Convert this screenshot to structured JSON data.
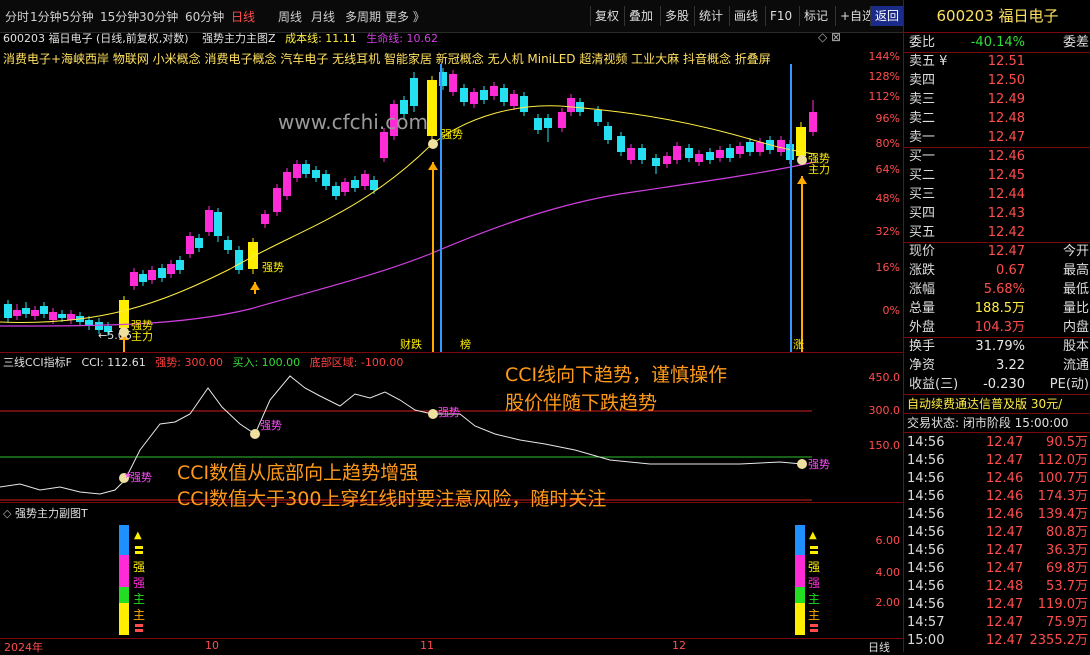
{
  "toolbar": {
    "left": [
      "分时",
      "1分钟",
      "5分钟",
      "15分钟",
      "30分钟",
      "60分钟",
      "日线",
      "周线",
      "月线",
      "多周期",
      "更多 》"
    ],
    "active": "日线",
    "right": [
      "复权",
      "叠加",
      "多股",
      "统计",
      "画线",
      "F10",
      "标记",
      "+自选",
      "返回"
    ]
  },
  "main_info": {
    "code_name": "600203 福日电子 (日线,前复权,对数)",
    "indicator": "强势主力主图Z",
    "cost_label": "成本线: 11.11",
    "life_label": "生命线: 10.62"
  },
  "concepts": "消费电子+海峡西岸 物联网 小米概念 消费电子概念 汽车电子 无线耳机 智能家居 新冠概念 无人机 MiniLED 超清视频 工业大麻 抖音概念 折叠屏",
  "watermark": "www.cfchi.com",
  "main_axis": [
    "144%",
    "128%",
    "112%",
    "96%",
    "80%",
    "64%",
    "48%",
    "32%",
    "16%",
    "0%"
  ],
  "cci_panel": {
    "title": "三线CCI指标F",
    "cci": "CCI: 112.61",
    "strong": "强势: 300.00",
    "buy": "买入: 100.00",
    "bottom": "底部区域: -100.00",
    "axis": [
      "450.0",
      "300.0",
      "150.0"
    ]
  },
  "sub_panel": {
    "title": "强势主力副图T",
    "axis": [
      "6.00",
      "4.00",
      "2.00"
    ]
  },
  "x_axis": [
    "2024年",
    "10",
    "11",
    "12",
    "日线"
  ],
  "markers": {
    "strong": "强势",
    "main": "主力",
    "cai": "财跌",
    "bang": "榜",
    "zhang": "涨",
    "cost_tag": "←5.06"
  },
  "annotations": {
    "box_line1": "CCI线向下趋势，谨慎操作",
    "box_line2": "股价伴随下跌趋势",
    "bottom_line1": "CCI数值从底部向上趋势增强",
    "bottom_line2": "CCI数值大于300上穿红线时要注意风险，随时关注"
  },
  "quote": {
    "title": "600203 福日电子",
    "weibi": {
      "label": "委比",
      "value": "-40.14%",
      "label2": "委差"
    },
    "asks": [
      {
        "label": "卖五 ¥",
        "price": "12.51"
      },
      {
        "label": "卖四",
        "price": "12.50"
      },
      {
        "label": "卖三",
        "price": "12.49"
      },
      {
        "label": "卖二",
        "price": "12.48"
      },
      {
        "label": "卖一",
        "price": "12.47"
      }
    ],
    "bids": [
      {
        "label": "买一",
        "price": "12.46"
      },
      {
        "label": "买二",
        "price": "12.45"
      },
      {
        "label": "买三",
        "price": "12.44"
      },
      {
        "label": "买四",
        "price": "12.43"
      },
      {
        "label": "买五",
        "price": "12.42"
      }
    ],
    "stats": [
      {
        "label": "现价",
        "value": "12.47",
        "right": "今开"
      },
      {
        "label": "涨跌",
        "value": "0.67",
        "right": "最高"
      },
      {
        "label": "涨幅",
        "value": "5.68%",
        "right": "最低"
      },
      {
        "label": "总量",
        "value": "188.5万",
        "right": "量比"
      },
      {
        "label": "外盘",
        "value": "104.3万",
        "right": "内盘"
      }
    ],
    "stats2": [
      {
        "label": "换手",
        "value": "31.79%",
        "right": "股本"
      },
      {
        "label": "净资",
        "value": "3.22",
        "right": "流通"
      },
      {
        "label": "收益(三)",
        "value": "-0.230",
        "right": "PE(动)"
      }
    ],
    "promo": "自动续费通达信普及版  30元/",
    "trade_state": "交易状态: 闭市阶段 15:00:00",
    "ticks": [
      {
        "t": "14:56",
        "p": "12.47",
        "v": "90.5万"
      },
      {
        "t": "14:56",
        "p": "12.47",
        "v": "112.0万"
      },
      {
        "t": "14:56",
        "p": "12.46",
        "v": "100.7万"
      },
      {
        "t": "14:56",
        "p": "12.46",
        "v": "174.3万"
      },
      {
        "t": "14:56",
        "p": "12.46",
        "v": "139.4万"
      },
      {
        "t": "14:56",
        "p": "12.47",
        "v": "80.8万"
      },
      {
        "t": "14:56",
        "p": "12.47",
        "v": "36.3万"
      },
      {
        "t": "14:56",
        "p": "12.47",
        "v": "69.8万"
      },
      {
        "t": "14:56",
        "p": "12.48",
        "v": "53.7万"
      },
      {
        "t": "14:56",
        "p": "12.47",
        "v": "119.0万"
      },
      {
        "t": "14:57",
        "p": "12.47",
        "v": "75.9万"
      },
      {
        "t": "15:00",
        "p": "12.47",
        "v": "2355.2万"
      }
    ]
  },
  "colors": {
    "up": "#ff2bd6",
    "down": "#25e0f0",
    "signal": "#ffee00",
    "cost": "#ffee44",
    "life": "#d040e0",
    "accent": "#ff4d4d"
  }
}
